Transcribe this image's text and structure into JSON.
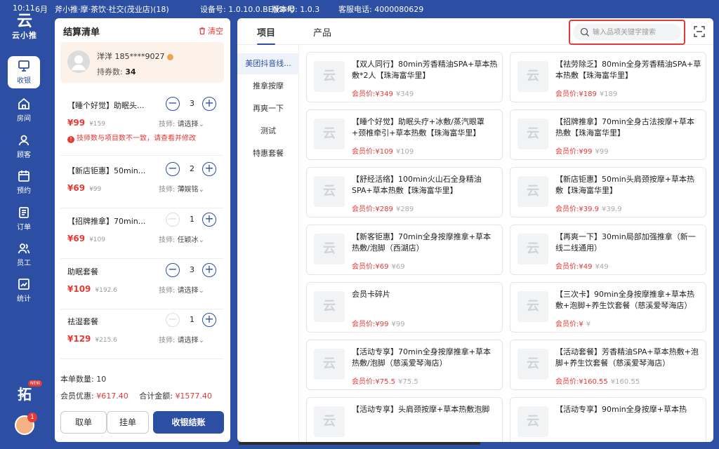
{
  "status": {
    "time": "10:11",
    "date": "6月",
    "store": "斧小推·摩·茶饮·社交(茂业店)(18)",
    "device": "设备号: 1.0.10.0.BENSHU",
    "version": "版本号: 1.0.3",
    "phone": "客服电话: 4000080629"
  },
  "brand": {
    "mark": "云",
    "name": "云小推"
  },
  "nav": [
    {
      "label": "收银",
      "icon": "cashier-icon"
    },
    {
      "label": "房间",
      "icon": "home-icon"
    },
    {
      "label": "顾客",
      "icon": "user-icon"
    },
    {
      "label": "预约",
      "icon": "calendar-icon"
    },
    {
      "label": "订单",
      "icon": "order-icon"
    },
    {
      "label": "员工",
      "icon": "staff-icon"
    },
    {
      "label": "统计",
      "icon": "stats-icon"
    }
  ],
  "nav_bottom": {
    "badge": "NEW",
    "glyph": "拓",
    "notify": "1"
  },
  "cart": {
    "title": "结算清单",
    "clear": "清空",
    "member": {
      "name": "洋洋 185****9027",
      "coupon_label": "持券数:",
      "coupon_count": "34"
    },
    "items": [
      {
        "name": "【睡个好觉】助眠头...",
        "price": "¥99",
        "orig": "¥159",
        "qty": "3",
        "tech_label": "技师:",
        "tech": "请选择",
        "warn": "技师数与项目数不一致，请查看并修改"
      },
      {
        "name": "【新店钜惠】50min...",
        "price": "¥69",
        "orig": "¥99",
        "qty": "2",
        "tech_label": "技师:",
        "tech": "薄娱铭"
      },
      {
        "name": "【招牌推拿】70min...",
        "price": "¥69",
        "orig": "¥109",
        "qty": "1",
        "tech_label": "技师:",
        "tech": "任颖冰"
      },
      {
        "name": "助眠套餐",
        "price": "¥109",
        "orig": "¥192.6",
        "qty": "3",
        "tech_label": "技师:",
        "tech": "请选择"
      },
      {
        "name": "祛湿套餐",
        "price": "¥129",
        "orig": "¥215.6",
        "qty": "1",
        "tech_label": "技师:",
        "tech": "请选择"
      }
    ],
    "summary": {
      "count_label": "本单数量:",
      "count": "10",
      "discount_label": "会员优惠:",
      "discount": "¥617.40",
      "total_label": "合计金额:",
      "total": "¥1577.40"
    },
    "buttons": {
      "take": "取单",
      "hold": "挂单",
      "checkout": "收银结账"
    }
  },
  "main": {
    "tabs": [
      "项目",
      "产品"
    ],
    "search_placeholder": "输入品项关键字搜索",
    "categories": [
      "美团抖音线...",
      "推拿按摩",
      "再爽一下",
      "测试",
      "特惠套餐"
    ],
    "price_label": "会员价:",
    "products": [
      {
        "name": "【双人同行】80min芳香精油SPA+草本热敷*2人【珠海富华里】",
        "price": "¥349",
        "orig": "¥349"
      },
      {
        "name": "【祛劳除乏】80min全身芳香精油SPA+草本热敷【珠海富华里】",
        "price": "¥189",
        "orig": "¥189"
      },
      {
        "name": "【睡个好觉】助眠头疗+冰敷/蒸汽眼罩+颈椎牵引+草本热敷【珠海富华里】",
        "price": "¥109",
        "orig": "¥109"
      },
      {
        "name": "【招牌推拿】70min全身古法按摩+草本热敷【珠海富华里】",
        "price": "¥99",
        "orig": "¥99"
      },
      {
        "name": "【舒经活络】100min火山石全身精油SPA+草本热敷【珠海富华里】",
        "price": "¥289",
        "orig": "¥289"
      },
      {
        "name": "【新店钜惠】50min头肩颈按摩+草本热敷【珠海富华里】",
        "price": "¥39.9",
        "orig": "¥39.9"
      },
      {
        "name": "【新客钜惠】70min全身按摩推拿+草本热敷/泡脚（西湖店）",
        "price": "¥69",
        "orig": "¥69"
      },
      {
        "name": "【再爽一下】30min局部加强推拿（新一线二线通用）",
        "price": "¥49",
        "orig": "¥49"
      },
      {
        "name": "会员卡碎片",
        "price": "¥99",
        "orig": "¥99"
      },
      {
        "name": "【三次卡】90min全身按摩推拿+草本热敷+泡脚+养生饮套餐（慈溪爱琴海店）",
        "price": "¥",
        "orig": "¥"
      },
      {
        "name": "【活动专享】70min全身按摩推拿+草本热敷/泡脚（慈溪爱琴海店）",
        "price": "¥75.5",
        "orig": "¥75.5"
      },
      {
        "name": "【活动套餐】芳香精油SPA+草本热敷+泡脚+养生饮套餐（慈溪爱琴海店）",
        "price": "¥160.55",
        "orig": "¥160.55"
      },
      {
        "name": "【活动专享】头肩颈按摩+草本热敷泡脚",
        "price": "",
        "orig": ""
      },
      {
        "name": "【活动专享】90min全身按摩+草本热",
        "price": "",
        "orig": ""
      }
    ]
  }
}
